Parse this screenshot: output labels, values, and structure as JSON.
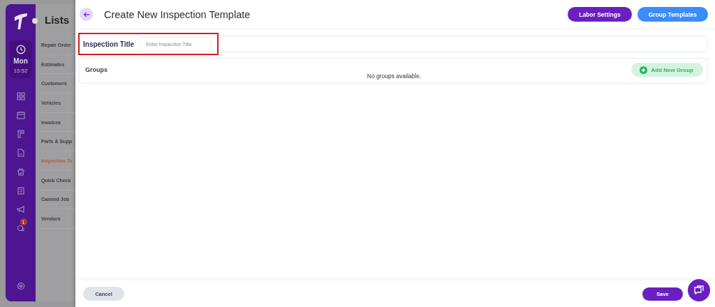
{
  "sidebar": {
    "day": "Mon",
    "time": "15:52",
    "nav": [
      {
        "kind": "grid"
      },
      {
        "kind": "calendar"
      },
      {
        "kind": "board"
      },
      {
        "kind": "document"
      },
      {
        "kind": "bag"
      },
      {
        "kind": "clipboard"
      },
      {
        "kind": "megaphone"
      },
      {
        "kind": "chat",
        "badge": "1"
      }
    ]
  },
  "lists": {
    "title": "Lists",
    "items": [
      {
        "label": "Repair Order",
        "selected": false
      },
      {
        "label": "Estimates",
        "selected": false
      },
      {
        "label": "Customers",
        "selected": false
      },
      {
        "label": "Vehicles",
        "selected": false
      },
      {
        "label": "Invoices",
        "selected": false
      },
      {
        "label": "Parts & Supp",
        "selected": false
      },
      {
        "label": "Inspection Te",
        "selected": true
      },
      {
        "label": "Quick Check",
        "selected": false
      },
      {
        "label": "Canned Job",
        "selected": false
      },
      {
        "label": "Vendors",
        "selected": false
      }
    ]
  },
  "drawer": {
    "title": "Create New Inspection Template",
    "header_buttons": [
      {
        "label": "Labor Settings",
        "kind": "primary"
      },
      {
        "label": "Group Templates",
        "kind": "secondary"
      }
    ],
    "inspection_title": {
      "label": "Inspection Title",
      "placeholder": "Enter Inspection Title",
      "highlighted": true
    },
    "groups": {
      "title": "Groups",
      "add_button": "Add New Group",
      "empty_text": "No groups available."
    },
    "footer": {
      "cancel": "Cancel",
      "save": "Save"
    }
  }
}
